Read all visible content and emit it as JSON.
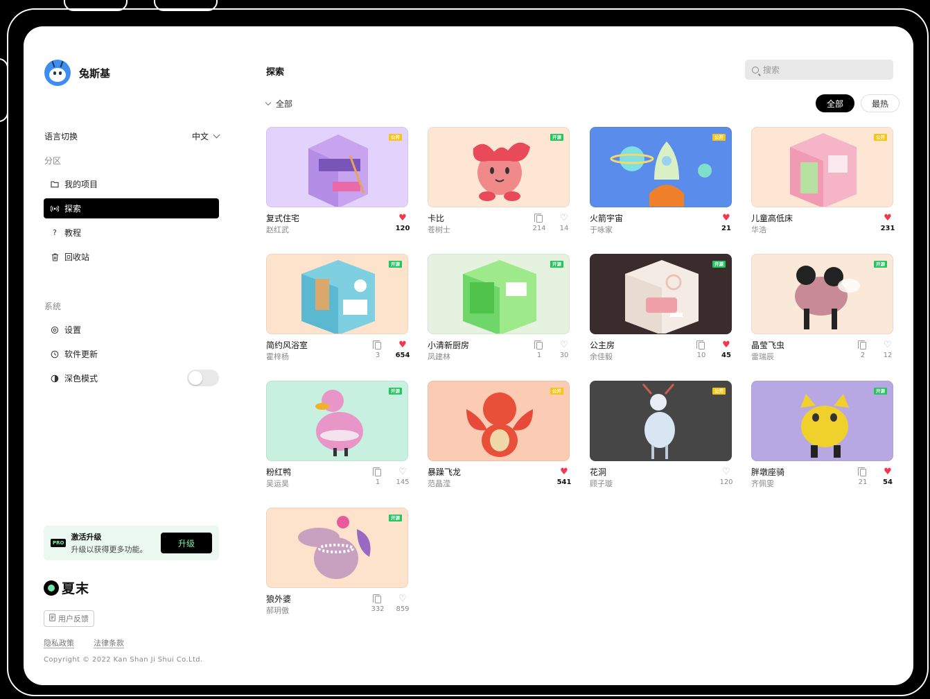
{
  "app": {
    "name": "兔斯基"
  },
  "sidebar": {
    "language_label": "语言切换",
    "language_value": "中文",
    "section_zone": "分区",
    "nav": [
      {
        "label": "我的项目",
        "icon": "folder-icon"
      },
      {
        "label": "探索",
        "icon": "broadcast-icon",
        "active": true
      },
      {
        "label": "教程",
        "icon": "question-icon"
      },
      {
        "label": "回收站",
        "icon": "trash-icon"
      }
    ],
    "section_system": "系统",
    "system": [
      {
        "label": "设置",
        "icon": "gear-icon"
      },
      {
        "label": "软件更新",
        "icon": "clock-icon"
      },
      {
        "label": "深色模式",
        "icon": "contrast-icon",
        "toggle": false
      }
    ],
    "upgrade": {
      "badge": "PRO",
      "title": "激活升级",
      "desc": "升级以获得更多功能。",
      "button": "升级"
    },
    "brand_mark": "夏末",
    "feedback": "用户反馈",
    "privacy": "隐私政策",
    "legal": "法律条款",
    "copyright": "Copyright © 2022 Kan Shan Ji Shui Co.Ltd."
  },
  "main": {
    "title": "探索",
    "search_placeholder": "搜索",
    "filter": "全部",
    "sort": [
      {
        "label": "全部",
        "active": true
      },
      {
        "label": "最热",
        "active": false
      }
    ],
    "colors": {
      "tag_public": "#f5c518",
      "tag_open": "#22c55e",
      "heart": "#f0384e"
    },
    "cards": [
      {
        "title": "复式住宅",
        "author": "赵红武",
        "tag": "公开",
        "tag_type": "public",
        "bg": "#e3d2fb",
        "copies": null,
        "likes": "120",
        "liked": true
      },
      {
        "title": "卡比",
        "author": "苍树士",
        "tag": "开源",
        "tag_type": "open",
        "bg": "#fde7d4",
        "copies": "214",
        "likes": "14",
        "liked": false
      },
      {
        "title": "火箭宇宙",
        "author": "于咏家",
        "tag": "公开",
        "tag_type": "public",
        "bg": "#5a8cec",
        "copies": null,
        "likes": "21",
        "liked": true
      },
      {
        "title": "儿童高低床",
        "author": "华浩",
        "tag": "公开",
        "tag_type": "public",
        "bg": "#fde7d4",
        "copies": null,
        "likes": "231",
        "liked": true
      },
      {
        "title": "简约风浴室",
        "author": "霍梓杨",
        "tag": "开源",
        "tag_type": "open",
        "bg": "#fde2cc",
        "copies": "3",
        "likes": "654",
        "liked": true
      },
      {
        "title": "小清新厨房",
        "author": "凤建林",
        "tag": "开源",
        "tag_type": "open",
        "bg": "#e6f2e0",
        "copies": "1",
        "likes": "30",
        "liked": false
      },
      {
        "title": "公主房",
        "author": "余佳毅",
        "tag": "开源",
        "tag_type": "open",
        "bg": "#3a2c2c",
        "copies": "10",
        "likes": "45",
        "liked": true
      },
      {
        "title": "晶莹飞虫",
        "author": "雷瑞辰",
        "tag": "开源",
        "tag_type": "open",
        "bg": "#fae8d8",
        "copies": "2",
        "likes": "12",
        "liked": false
      },
      {
        "title": "粉红鸭",
        "author": "吴运昊",
        "tag": "开源",
        "tag_type": "open",
        "bg": "#c7f0e0",
        "copies": "1",
        "likes": "145",
        "liked": false
      },
      {
        "title": "暴躁飞龙",
        "author": "范晶滢",
        "tag": "公开",
        "tag_type": "public",
        "bg": "#fccbb4",
        "copies": null,
        "likes": "541",
        "liked": true
      },
      {
        "title": "花洞",
        "author": "顾子璇",
        "tag": "公开",
        "tag_type": "public",
        "bg": "#464646",
        "copies": null,
        "likes": "120",
        "liked": false
      },
      {
        "title": "胖墩座骑",
        "author": "齐佩雯",
        "tag": "开源",
        "tag_type": "open",
        "bg": "#b7a8e4",
        "copies": "21",
        "likes": "54",
        "liked": true
      },
      {
        "title": "狼外婆",
        "author": "郝玥傲",
        "tag": "开源",
        "tag_type": "open",
        "bg": "#fde2cc",
        "copies": "332",
        "likes": "859",
        "liked": false
      }
    ]
  }
}
